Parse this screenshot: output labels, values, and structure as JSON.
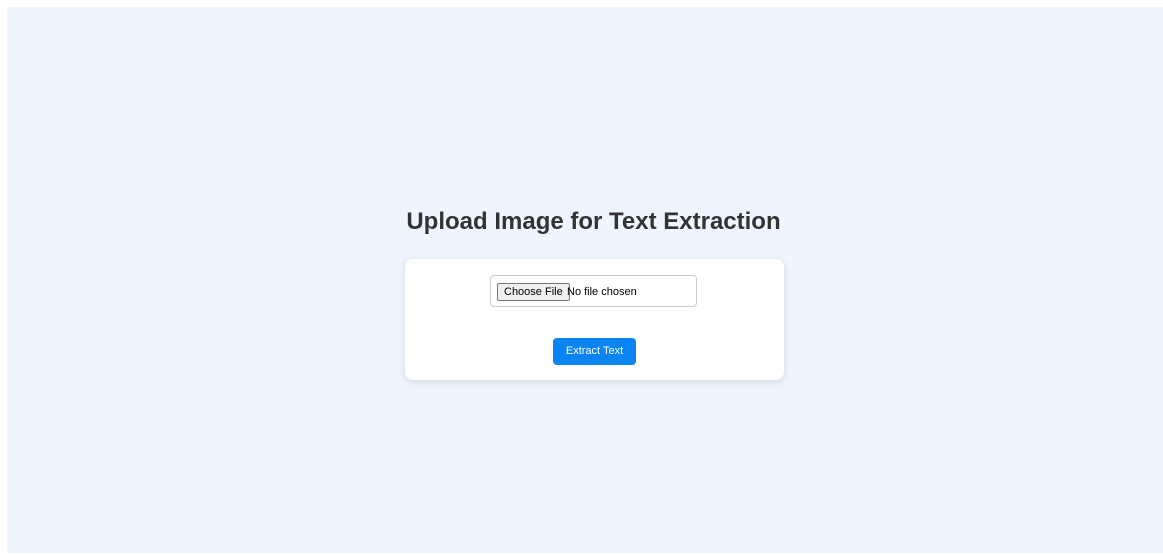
{
  "page": {
    "title": "Upload Image for Text Extraction"
  },
  "upload_form": {
    "choose_file_label": "Choose File",
    "file_status": "No file chosen",
    "extract_label": "Extract Text"
  },
  "colors": {
    "background": "#eef5fe",
    "card": "#ffffff",
    "accent": "#0a84f5",
    "title_text": "#333333"
  }
}
